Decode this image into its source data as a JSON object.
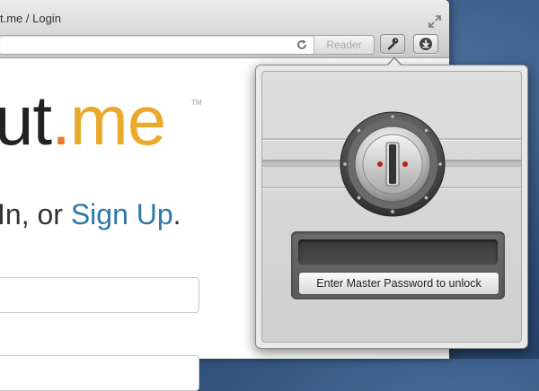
{
  "window": {
    "title": "t.me / Login"
  },
  "toolbar": {
    "address_value": "",
    "reader_label": "Reader",
    "icons": [
      "reload-icon",
      "key-icon",
      "download-icon",
      "fullscreen-icon"
    ]
  },
  "page": {
    "logo_dark": "ut",
    "logo_dot": ".",
    "logo_orange": "me",
    "trademark": "TM",
    "signin_prefix": "In, or ",
    "signup_link": "Sign Up",
    "signin_suffix": "."
  },
  "popover": {
    "password_value": "",
    "unlock_label": "Enter Master Password to unlock",
    "icon": "vault-lock-icon"
  },
  "colors": {
    "logo_orange": "#eaa92a",
    "logo_dot": "#e8762d",
    "link_blue": "#2e78a8",
    "desktop_blue": "#2f4f79"
  }
}
